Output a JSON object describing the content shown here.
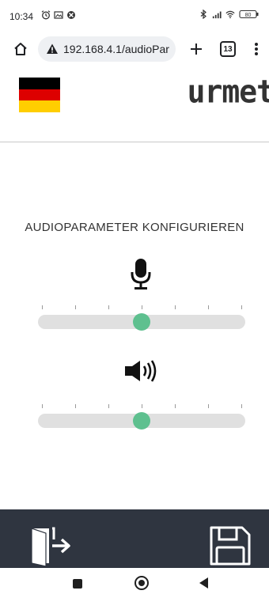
{
  "status_bar": {
    "time": "10:34",
    "left_icons": [
      "alarm-icon",
      "gallery-icon",
      "xbox-icon"
    ],
    "right_icons": [
      "bluetooth-icon",
      "signal-icon",
      "wifi-icon",
      "battery-icon"
    ],
    "battery": "80"
  },
  "browser": {
    "url": "192.168.4.1/audioPar",
    "tab_count": "13",
    "security_icon": "warning-triangle-icon"
  },
  "header": {
    "language_flag": "germany-flag",
    "flag_colors": [
      "#000000",
      "#dd0000",
      "#ffce00"
    ],
    "brand": "urmet"
  },
  "main": {
    "title": "AUDIOPARAMETER KONFIGURIEREN",
    "microphone_slider": {
      "icon": "microphone-icon",
      "ticks": 7,
      "value": 0.5
    },
    "speaker_slider": {
      "icon": "speaker-volume-icon",
      "ticks": 7,
      "value": 0.5
    },
    "accent_color": "#5ec08f"
  },
  "footer": {
    "exit_icon": "exit-door-icon",
    "save_icon": "floppy-save-icon",
    "background": "#2f3540"
  }
}
